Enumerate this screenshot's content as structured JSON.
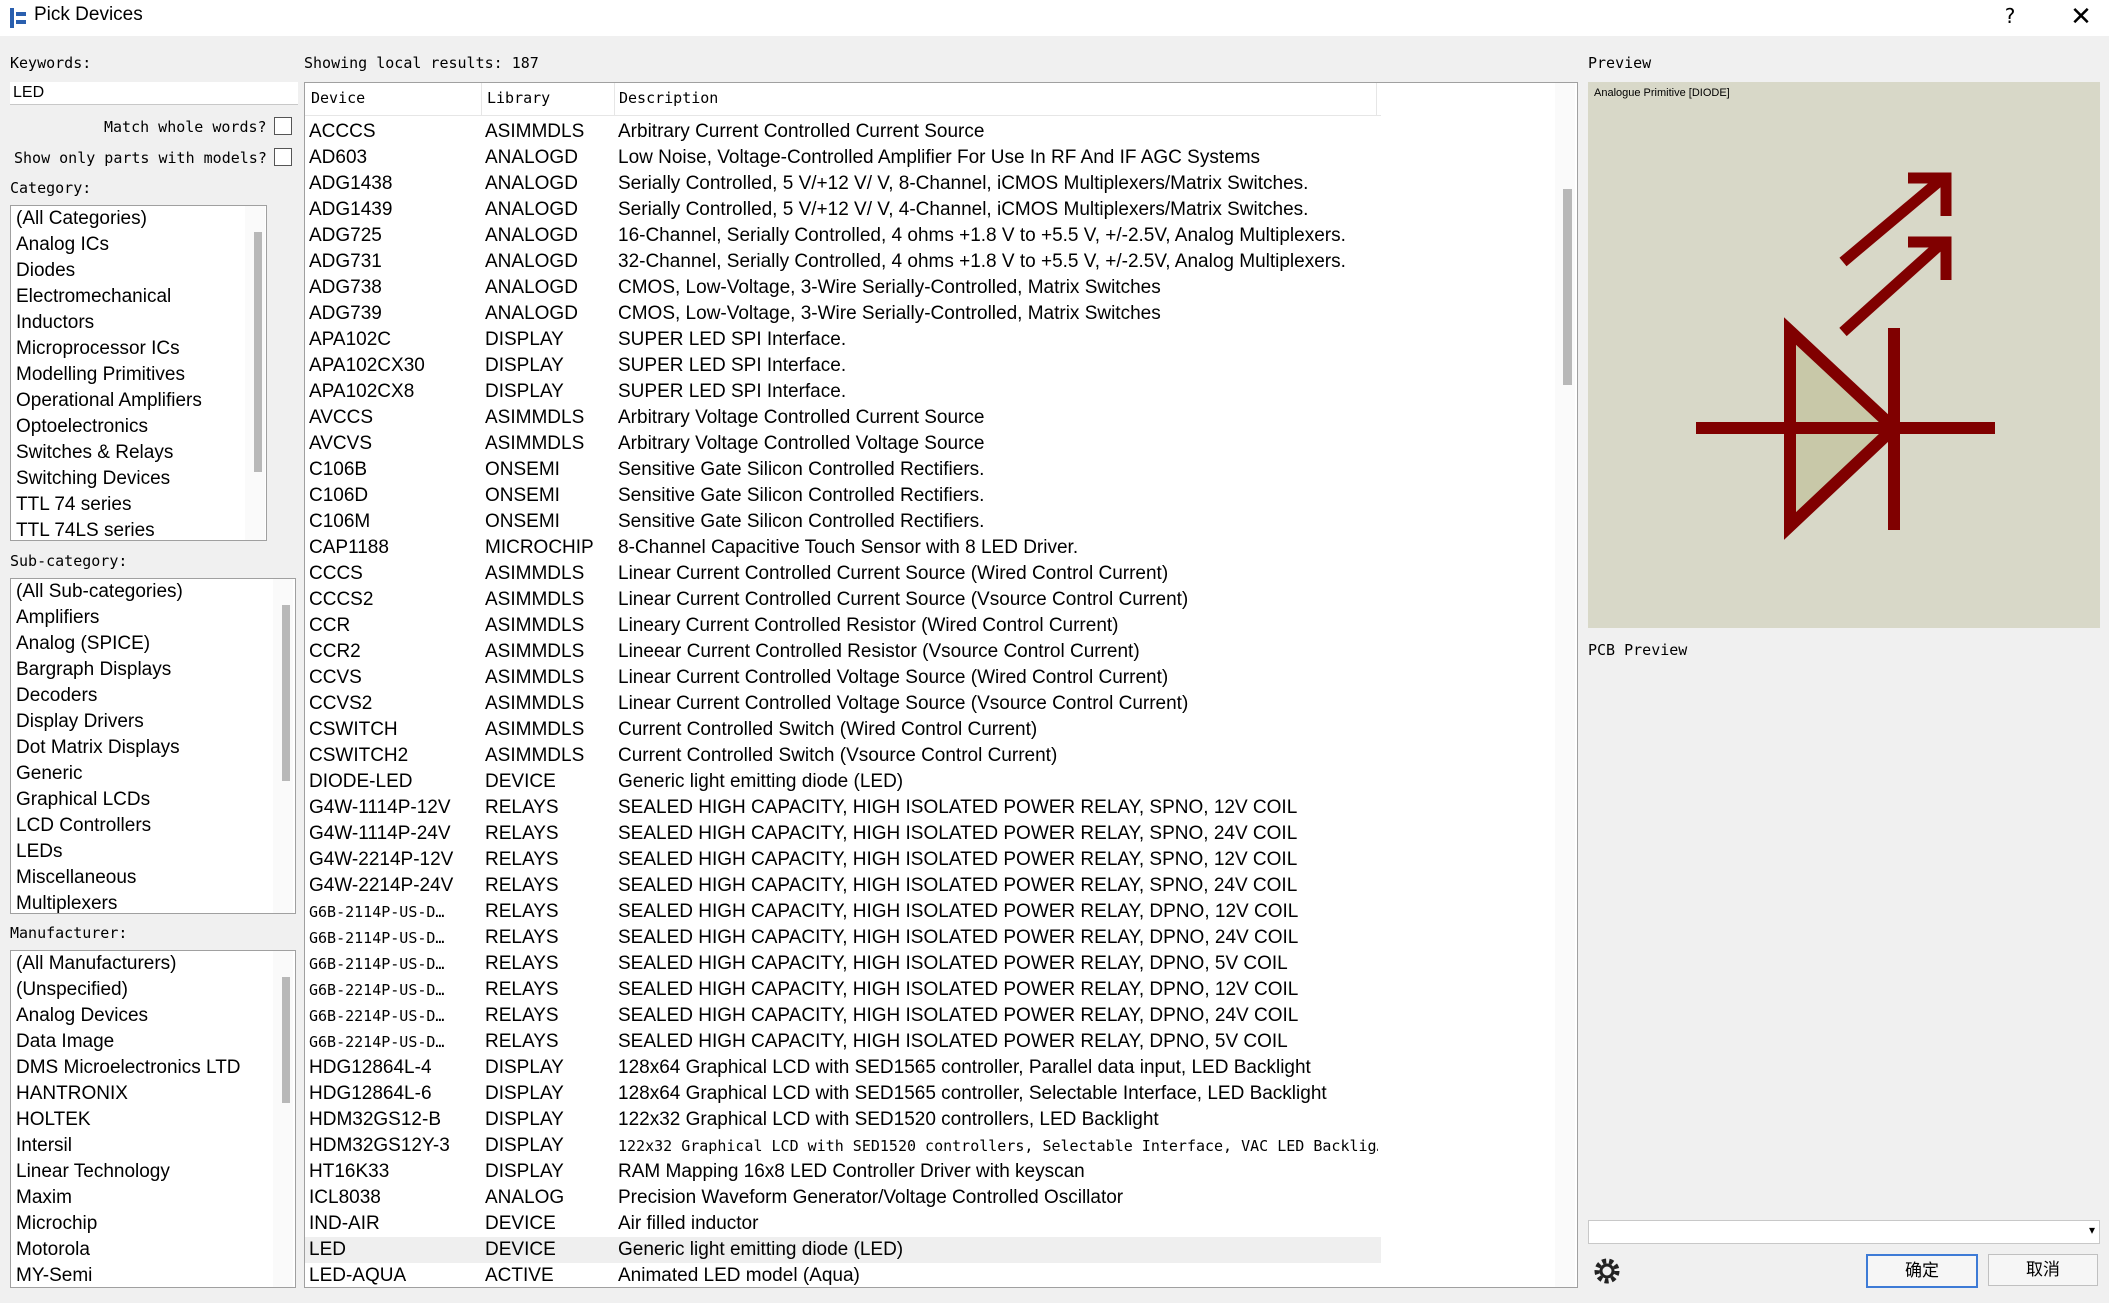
{
  "window": {
    "title": "Pick Devices",
    "help": "?",
    "close": "✕"
  },
  "keywords": {
    "label": "Keywords:",
    "value": "LED"
  },
  "options": {
    "match_whole": "Match whole words?",
    "only_models": "Show only parts with models?"
  },
  "category": {
    "label": "Category:",
    "items": [
      "(All Categories)",
      "Analog ICs",
      "Diodes",
      "Electromechanical",
      "Inductors",
      "Microprocessor ICs",
      "Modelling Primitives",
      "Operational Amplifiers",
      "Optoelectronics",
      "Switches & Relays",
      "Switching Devices",
      "TTL 74 series",
      "TTL 74LS series"
    ]
  },
  "subcategory": {
    "label": "Sub-category:",
    "items": [
      "(All Sub-categories)",
      "Amplifiers",
      "Analog (SPICE)",
      "Bargraph Displays",
      "Decoders",
      "Display Drivers",
      "Dot Matrix Displays",
      "Generic",
      "Graphical LCDs",
      "LCD Controllers",
      "LEDs",
      "Miscellaneous",
      "Multiplexers"
    ]
  },
  "manufacturer": {
    "label": "Manufacturer:",
    "items": [
      "(All Manufacturers)",
      "(Unspecified)",
      "Analog Devices",
      "Data Image",
      "DMS Microelectronics LTD",
      "HANTRONIX",
      "HOLTEK",
      "Intersil",
      "Linear Technology",
      "Maxim",
      "Microchip",
      "Motorola",
      "MY-Semi"
    ]
  },
  "results": {
    "status": "Showing local results: 187",
    "columns": [
      "Device",
      "Library",
      "Description"
    ],
    "rows": [
      {
        "device": "ACCCS",
        "library": "ASIMMDLS",
        "description": "Arbitrary Current Controlled Current Source"
      },
      {
        "device": "AD603",
        "library": "ANALOGD",
        "description": "Low Noise, Voltage-Controlled Amplifier For Use In RF And IF AGC Systems"
      },
      {
        "device": "ADG1438",
        "library": "ANALOGD",
        "description": "Serially Controlled, 5 V/+12 V/ V, 8-Channel, iCMOS Multiplexers/Matrix Switches."
      },
      {
        "device": "ADG1439",
        "library": "ANALOGD",
        "description": "Serially Controlled, 5 V/+12 V/ V, 4-Channel, iCMOS Multiplexers/Matrix Switches."
      },
      {
        "device": "ADG725",
        "library": "ANALOGD",
        "description": "16-Channel, Serially Controlled, 4 ohms +1.8 V to +5.5 V, +/-2.5V, Analog Multiplexers."
      },
      {
        "device": "ADG731",
        "library": "ANALOGD",
        "description": "32-Channel, Serially Controlled, 4 ohms +1.8 V to +5.5 V, +/-2.5V, Analog Multiplexers."
      },
      {
        "device": "ADG738",
        "library": "ANALOGD",
        "description": "CMOS, Low-Voltage, 3-Wire Serially-Controlled, Matrix Switches"
      },
      {
        "device": "ADG739",
        "library": "ANALOGD",
        "description": "CMOS, Low-Voltage, 3-Wire Serially-Controlled, Matrix Switches"
      },
      {
        "device": "APA102C",
        "library": "DISPLAY",
        "description": "SUPER LED SPI Interface."
      },
      {
        "device": "APA102CX30",
        "library": "DISPLAY",
        "description": "SUPER LED SPI Interface."
      },
      {
        "device": "APA102CX8",
        "library": "DISPLAY",
        "description": "SUPER LED SPI Interface."
      },
      {
        "device": "AVCCS",
        "library": "ASIMMDLS",
        "description": "Arbitrary Voltage Controlled Current Source"
      },
      {
        "device": "AVCVS",
        "library": "ASIMMDLS",
        "description": "Arbitrary Voltage Controlled Voltage Source"
      },
      {
        "device": "C106B",
        "library": "ONSEMI",
        "description": "Sensitive Gate Silicon Controlled Rectifiers."
      },
      {
        "device": "C106D",
        "library": "ONSEMI",
        "description": "Sensitive Gate Silicon Controlled Rectifiers."
      },
      {
        "device": "C106M",
        "library": "ONSEMI",
        "description": "Sensitive Gate Silicon Controlled Rectifiers."
      },
      {
        "device": "CAP1188",
        "library": "MICROCHIP",
        "description": "8-Channel Capacitive Touch Sensor with 8 LED Driver."
      },
      {
        "device": "CCCS",
        "library": "ASIMMDLS",
        "description": "Linear Current Controlled Current Source (Wired Control Current)"
      },
      {
        "device": "CCCS2",
        "library": "ASIMMDLS",
        "description": "Linear Current Controlled Current Source (Vsource Control Current)"
      },
      {
        "device": "CCR",
        "library": "ASIMMDLS",
        "description": "Lineary Current Controlled Resistor (Wired Control Current)"
      },
      {
        "device": "CCR2",
        "library": "ASIMMDLS",
        "description": "Lineear Current Controlled Resistor (Vsource Control Current)"
      },
      {
        "device": "CCVS",
        "library": "ASIMMDLS",
        "description": "Linear Current Controlled Voltage Source (Wired Control Current)"
      },
      {
        "device": "CCVS2",
        "library": "ASIMMDLS",
        "description": "Linear Current Controlled Voltage Source (Vsource Control Current)"
      },
      {
        "device": "CSWITCH",
        "library": "ASIMMDLS",
        "description": "Current Controlled Switch (Wired Control Current)"
      },
      {
        "device": "CSWITCH2",
        "library": "ASIMMDLS",
        "description": "Current Controlled Switch (Vsource Control Current)"
      },
      {
        "device": "DIODE-LED",
        "library": "DEVICE",
        "description": "Generic light emitting diode (LED)"
      },
      {
        "device": "G4W-1114P-12V",
        "library": "RELAYS",
        "description": "SEALED HIGH CAPACITY, HIGH ISOLATED POWER RELAY, SPNO, 12V COIL"
      },
      {
        "device": "G4W-1114P-24V",
        "library": "RELAYS",
        "description": "SEALED HIGH CAPACITY, HIGH ISOLATED POWER RELAY, SPNO, 24V COIL"
      },
      {
        "device": "G4W-2214P-12V",
        "library": "RELAYS",
        "description": "SEALED HIGH CAPACITY, HIGH ISOLATED POWER RELAY, SPNO, 12V COIL"
      },
      {
        "device": "G4W-2214P-24V",
        "library": "RELAYS",
        "description": "SEALED HIGH CAPACITY, HIGH ISOLATED POWER RELAY, SPNO, 24V COIL"
      },
      {
        "device": "G6B-2114P-US-D…",
        "library": "RELAYS",
        "description": "SEALED HIGH CAPACITY, HIGH ISOLATED POWER RELAY, DPNO, 12V COIL",
        "mono_device": true
      },
      {
        "device": "G6B-2114P-US-D…",
        "library": "RELAYS",
        "description": "SEALED HIGH CAPACITY, HIGH ISOLATED POWER RELAY, DPNO, 24V COIL",
        "mono_device": true
      },
      {
        "device": "G6B-2114P-US-D…",
        "library": "RELAYS",
        "description": "SEALED HIGH CAPACITY, HIGH ISOLATED POWER RELAY, DPNO, 5V COIL",
        "mono_device": true
      },
      {
        "device": "G6B-2214P-US-D…",
        "library": "RELAYS",
        "description": "SEALED HIGH CAPACITY, HIGH ISOLATED POWER RELAY, DPNO, 12V COIL",
        "mono_device": true
      },
      {
        "device": "G6B-2214P-US-D…",
        "library": "RELAYS",
        "description": "SEALED HIGH CAPACITY, HIGH ISOLATED POWER RELAY, DPNO, 24V COIL",
        "mono_device": true
      },
      {
        "device": "G6B-2214P-US-D…",
        "library": "RELAYS",
        "description": "SEALED HIGH CAPACITY, HIGH ISOLATED POWER RELAY, DPNO, 5V COIL",
        "mono_device": true
      },
      {
        "device": "HDG12864L-4",
        "library": "DISPLAY",
        "description": "128x64 Graphical LCD with SED1565 controller, Parallel data input, LED Backlight"
      },
      {
        "device": "HDG12864L-6",
        "library": "DISPLAY",
        "description": "128x64 Graphical LCD with SED1565 controller, Selectable Interface, LED Backlight"
      },
      {
        "device": "HDM32GS12-B",
        "library": "DISPLAY",
        "description": "122x32 Graphical LCD with SED1520 controllers, LED Backlight"
      },
      {
        "device": "HDM32GS12Y-3",
        "library": "DISPLAY",
        "description": "122x32 Graphical LCD with SED1520 controllers, Selectable Interface, VAC LED Backlig…",
        "mono_description": true
      },
      {
        "device": "HT16K33",
        "library": "DISPLAY",
        "description": "RAM Mapping 16x8 LED Controller Driver with keyscan"
      },
      {
        "device": "ICL8038",
        "library": "ANALOG",
        "description": "Precision Waveform Generator/Voltage Controlled Oscillator"
      },
      {
        "device": "IND-AIR",
        "library": "DEVICE",
        "description": "Air filled inductor"
      },
      {
        "device": "LED",
        "library": "DEVICE",
        "description": "Generic light emitting diode (LED)",
        "selected": true
      },
      {
        "device": "LED-AQUA",
        "library": "ACTIVE",
        "description": "Animated LED model (Aqua)"
      }
    ]
  },
  "preview": {
    "label": "Preview",
    "caption": "Analogue Primitive [DIODE]",
    "pcb_label": "PCB Preview",
    "symbol_color": "#800000",
    "symbol_fill": "#c8c8a8",
    "background": "#d8d8c8"
  },
  "buttons": {
    "ok": "确定",
    "cancel": "取消",
    "settings_icon": "gear-icon"
  }
}
